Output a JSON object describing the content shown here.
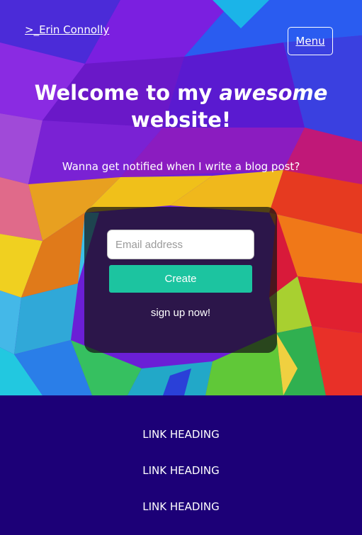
{
  "header": {
    "brand_link": ">_Erin Connolly",
    "menu_label": "Menu"
  },
  "hero": {
    "title_prefix": "Welcome to my ",
    "title_emphasis": "awesome",
    "title_suffix": "website!",
    "subtitle": "Wanna get notified when I write a blog post?"
  },
  "signup": {
    "email_placeholder": "Email address",
    "create_label": "Create",
    "note": "sign up now!"
  },
  "footer": {
    "links": [
      "LINK HEADING",
      "LINK HEADING",
      "LINK HEADING"
    ]
  },
  "colors": {
    "footer_background": "#1c0077",
    "button_accent": "#1cc4a0"
  }
}
